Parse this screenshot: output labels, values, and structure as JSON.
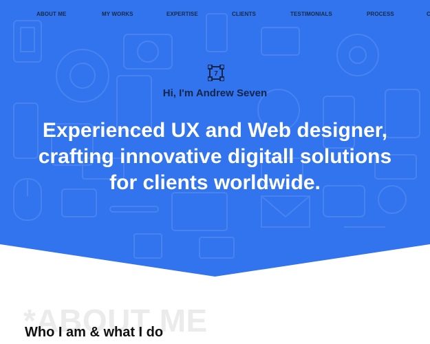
{
  "nav": {
    "items": [
      {
        "label": "ABOUT ME"
      },
      {
        "label": "MY WORKS"
      },
      {
        "label": "EXPERTISE"
      },
      {
        "label": "CLIENTS"
      },
      {
        "label": "TESTIMONIALS"
      },
      {
        "label": "PROCESS"
      },
      {
        "label": "C"
      }
    ]
  },
  "hero": {
    "logo_glyph": "7",
    "greeting": "Hi, I'm Andrew Seven",
    "headline_lines": [
      "Experienced UX and Web designer,",
      "crafting innovative digitall solutions",
      "for clients worldwide."
    ],
    "background_color": "#3174ee"
  },
  "about": {
    "background_title": "*ABOUT ME",
    "title": "Who I am & what I do"
  }
}
